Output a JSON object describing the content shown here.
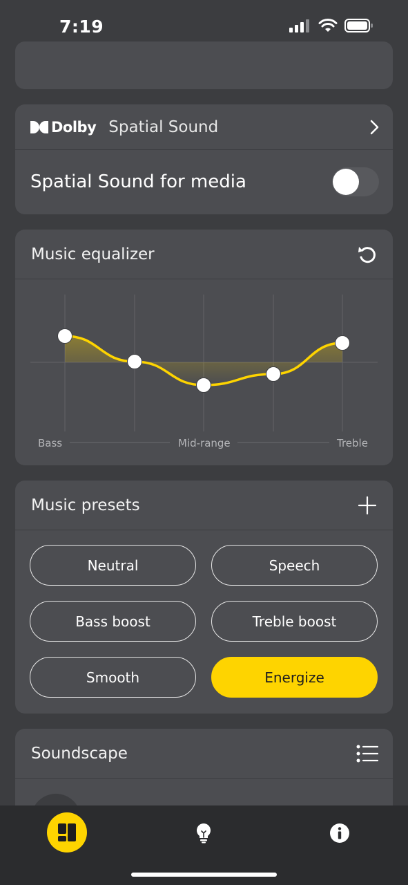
{
  "status_bar": {
    "time": "7:19"
  },
  "dolby": {
    "brand": "Dolby",
    "title": "Spatial Sound",
    "toggle_label": "Spatial Sound for media",
    "toggle_on": false
  },
  "equalizer": {
    "title": "Music equalizer",
    "labels": {
      "bass": "Bass",
      "mid": "Mid-range",
      "treble": "Treble"
    },
    "bands": [
      0.38,
      0.01,
      -0.33,
      -0.17,
      0.28
    ]
  },
  "presets": {
    "title": "Music presets",
    "items": [
      {
        "label": "Neutral",
        "active": false
      },
      {
        "label": "Speech",
        "active": false
      },
      {
        "label": "Bass boost",
        "active": false
      },
      {
        "label": "Treble boost",
        "active": false
      },
      {
        "label": "Smooth",
        "active": false
      },
      {
        "label": "Energize",
        "active": true
      }
    ]
  },
  "soundscape": {
    "title": "Soundscape"
  },
  "tab_bar": {
    "active_tab": "home"
  },
  "colors": {
    "accent": "#fed400",
    "card": "#4c4d51",
    "background": "#3c3d40",
    "tab_bar": "#2b2c2e"
  }
}
